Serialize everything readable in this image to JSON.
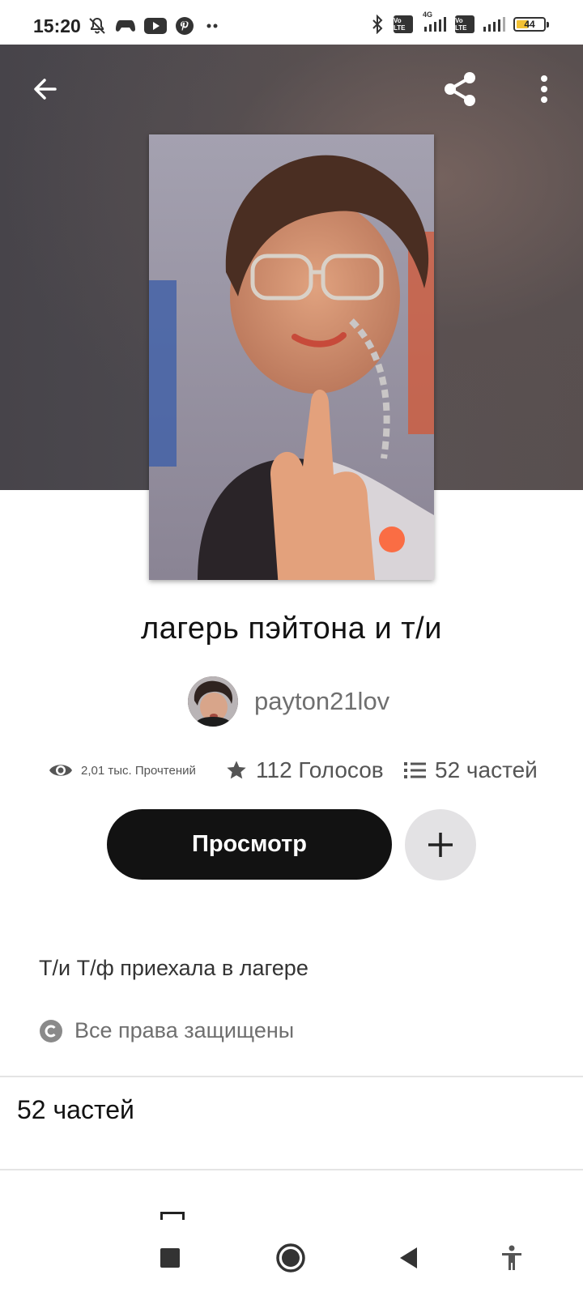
{
  "status_bar": {
    "time": "15:20",
    "lte1": "Vo LTE",
    "network": "4G",
    "lte2": "Vo LTE",
    "battery": "44",
    "icons": [
      "mute-bell-icon",
      "gamepad-icon",
      "youtube-icon",
      "pinterest-icon",
      "more-dots-icon",
      "bluetooth-icon",
      "signal-icon",
      "battery-icon"
    ]
  },
  "header": {
    "icons": [
      "back-arrow-icon",
      "share-icon",
      "more-vertical-icon"
    ]
  },
  "story": {
    "title": "лагерь пэйтона и т/и",
    "author": "payton21lov",
    "stats": {
      "reads": "2,01 тыс. Прочтений",
      "votes": "112 Голосов",
      "parts": "52 частей"
    },
    "read_button": "Просмотр",
    "description": "Т/и Т/ф приехала в лагере",
    "copyright": "Все права защищены",
    "parts_heading": "52 частей"
  },
  "nav_bar": {
    "icons": [
      "square-recents-icon",
      "circle-home-icon",
      "triangle-back-icon",
      "accessibility-icon"
    ]
  },
  "colors": {
    "primary_button": "#121212",
    "secondary_button": "#e3e2e4",
    "text_primary": "#121212",
    "text_secondary": "#6f6f6f"
  }
}
